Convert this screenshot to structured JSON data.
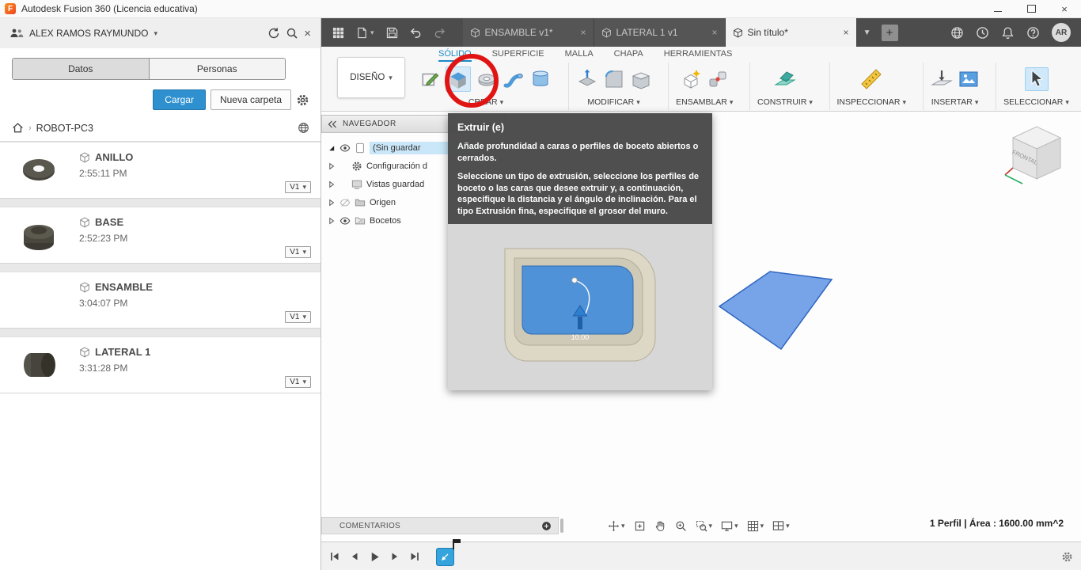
{
  "titlebar": {
    "title": "Autodesk Fusion 360 (Licencia educativa)"
  },
  "data_panel": {
    "user_name": "ALEX RAMOS RAYMUNDO",
    "tabs": {
      "datos": "Datos",
      "personas": "Personas"
    },
    "upload_button": "Cargar",
    "new_folder_button": "Nueva carpeta",
    "breadcrumb_root": "ROBOT-PC3",
    "items": [
      {
        "name": "ANILLO",
        "time": "2:55:11 PM",
        "version": "V1"
      },
      {
        "name": "BASE",
        "time": "2:52:23 PM",
        "version": "V1"
      },
      {
        "name": "ENSAMBLE",
        "time": "3:04:07 PM",
        "version": "V1"
      },
      {
        "name": "LATERAL 1",
        "time": "3:31:28 PM",
        "version": "V1"
      }
    ]
  },
  "document_tabs": {
    "tabs": [
      {
        "label": "ENSAMBLE v1*"
      },
      {
        "label": "LATERAL 1 v1"
      },
      {
        "label": "Sin título*"
      }
    ],
    "avatar": "AR"
  },
  "ribbon": {
    "workspace": "DISEÑO",
    "tabs": [
      "SÓLIDO",
      "SUPERFICIE",
      "MALLA",
      "CHAPA",
      "HERRAMIENTAS"
    ],
    "groups": {
      "crear": "CREAR",
      "modificar": "MODIFICAR",
      "ensamblar": "ENSAMBLAR",
      "construir": "CONSTRUIR",
      "inspeccionar": "INSPECCIONAR",
      "insertar": "INSERTAR",
      "seleccionar": "SELECCIONAR"
    }
  },
  "navigator": {
    "title": "NAVEGADOR",
    "rows": [
      {
        "label": "(Sin guardar"
      },
      {
        "label": "Configuración d"
      },
      {
        "label": "Vistas guardad"
      },
      {
        "label": "Origen"
      },
      {
        "label": "Bocetos"
      }
    ]
  },
  "tooltip": {
    "title": "Extruir (e)",
    "body1": "Añade profundidad a caras o perfiles de boceto abiertos o cerrados.",
    "body2": "Seleccione un tipo de extrusión, seleccione los perfiles de boceto o las caras que desee extruir y, a continuación, especifique la distancia y el ángulo de inclinación. Para el tipo Extrusión fina, especifique el grosor del muro.",
    "dimension": "10.00"
  },
  "viewcube": {
    "front_face": "FRONTAL"
  },
  "comments": {
    "label": "COMENTARIOS"
  },
  "statusbar": {
    "selection_info": "1 Perfil | Área : 1600.00 mm^2"
  }
}
